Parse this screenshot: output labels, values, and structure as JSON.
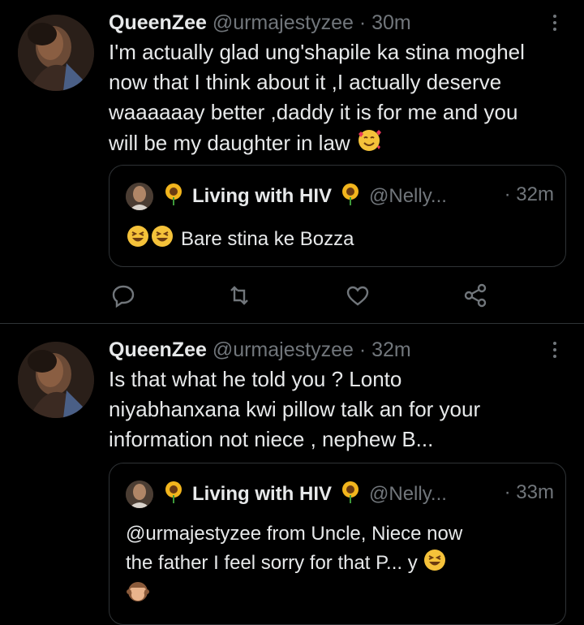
{
  "tweets": [
    {
      "author_name": "QueenZee",
      "author_handle": "@urmajestyzee",
      "time": "30m",
      "separator": "·",
      "text_lines": [
        "I'm actually glad ung'shapile ka stina moghel",
        "now that I think about it ,I actually deserve",
        "waaaaaay better ,daddy it is for me and you",
        "will be my daughter in law"
      ],
      "quote": {
        "author_name": "Living with HIV",
        "author_handle": "@Nelly...",
        "time": "· 32m",
        "text": "Bare stina ke Bozza"
      }
    },
    {
      "author_name": "QueenZee",
      "author_handle": "@urmajestyzee",
      "time": "32m",
      "separator": "·",
      "text_lines": [
        "Is that what he told you ? Lonto",
        "niyabhanxana kwi pillow talk an for your",
        "information not niece , nephew B..."
      ],
      "quote": {
        "author_name": "Living with HIV",
        "author_handle": "@Nelly...",
        "time": "· 33m",
        "text_lines": [
          "@urmajestyzee from Uncle, Niece now",
          "the father I feel sorry for that P... y"
        ]
      }
    }
  ],
  "icons": [
    "more-icon",
    "reply-icon",
    "retweet-icon",
    "like-icon",
    "share-icon",
    "sunflower-icon",
    "smiling-hearts-emoji",
    "laughing-emoji",
    "see-no-evil-monkey-emoji"
  ],
  "colors": {
    "background": "#000000",
    "text": "#e7e9ea",
    "secondary": "#71767b",
    "border": "#2f3336"
  }
}
